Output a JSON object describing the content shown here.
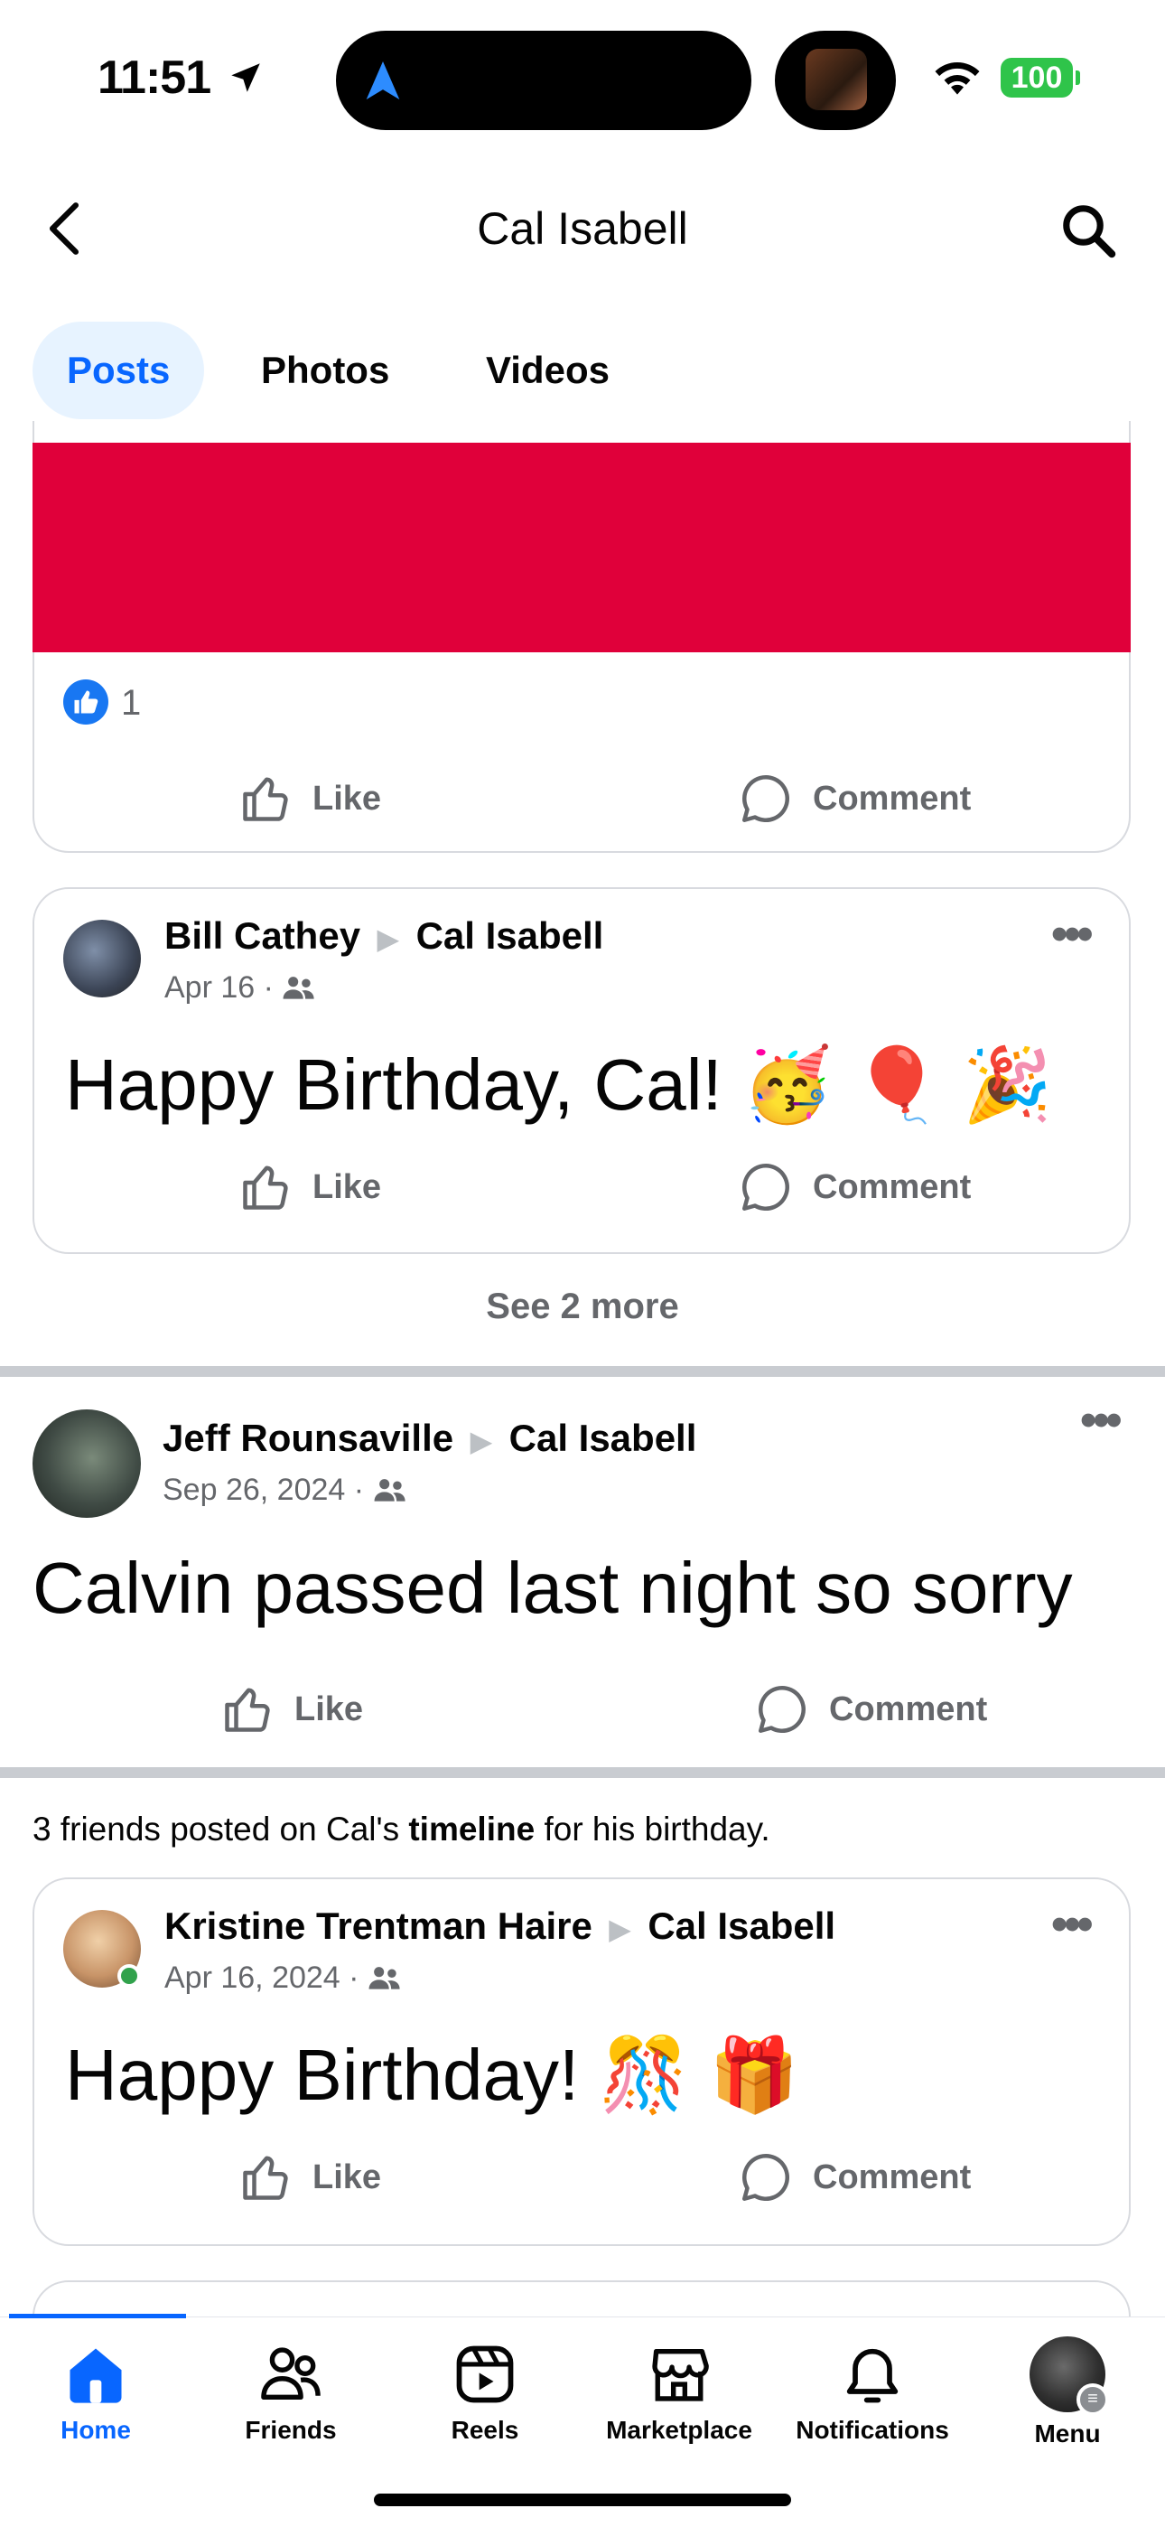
{
  "status_bar": {
    "time": "11:51",
    "battery": "100"
  },
  "header": {
    "title": "Cal Isabell"
  },
  "tabs": [
    {
      "label": "Posts",
      "active": true
    },
    {
      "label": "Photos",
      "active": false
    },
    {
      "label": "Videos",
      "active": false
    }
  ],
  "top_card": {
    "banner_color": "#e0003a",
    "reaction_count": "1",
    "like_label": "Like",
    "comment_label": "Comment"
  },
  "post1": {
    "author": "Bill Cathey",
    "target": "Cal Isabell",
    "date": "Apr 16",
    "text": "Happy Birthday, Cal! 🥳 🎈 🎉",
    "like_label": "Like",
    "comment_label": "Comment"
  },
  "see_more": "See 2 more",
  "post2": {
    "author": "Jeff Rounsaville",
    "target": "Cal Isabell",
    "date": "Sep 26, 2024",
    "text": "Calvin passed last night so sorry",
    "like_label": "Like",
    "comment_label": "Comment"
  },
  "birthday_summary": {
    "prefix": "3 friends posted on Cal's ",
    "bold": "timeline",
    "suffix": " for his birthday."
  },
  "post3": {
    "author": "Kristine Trentman Haire",
    "target": "Cal Isabell",
    "date": "Apr 16, 2024",
    "text": "Happy Birthday! 🎊 🎁",
    "like_label": "Like",
    "comment_label": "Comment"
  },
  "bottom_nav": [
    {
      "label": "Home",
      "icon": "home-icon",
      "active": true
    },
    {
      "label": "Friends",
      "icon": "friends-icon",
      "active": false
    },
    {
      "label": "Reels",
      "icon": "reels-icon",
      "active": false
    },
    {
      "label": "Marketplace",
      "icon": "marketplace-icon",
      "active": false
    },
    {
      "label": "Notifications",
      "icon": "bell-icon",
      "active": false
    },
    {
      "label": "Menu",
      "icon": "avatar",
      "active": false
    }
  ],
  "colors": {
    "accent": "#0866ff",
    "banner": "#e0003a",
    "muted": "#65676b"
  }
}
